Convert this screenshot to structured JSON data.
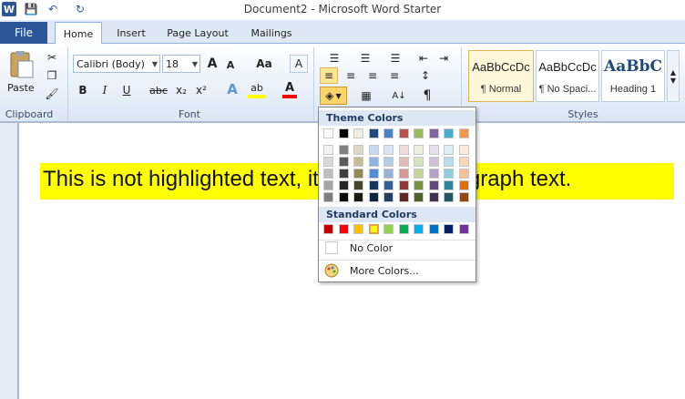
{
  "window": {
    "title": "Document2 - Microsoft Word Starter"
  },
  "quick_access": {
    "word_logo": "W",
    "save_icon": "💾",
    "undo_icon": "↶",
    "redo_icon": "↻"
  },
  "tabs": {
    "file": "File",
    "home": "Home",
    "insert": "Insert",
    "page_layout": "Page Layout",
    "mailings": "Mailings"
  },
  "clipboard": {
    "paste": "Paste",
    "group": "Clipboard"
  },
  "font": {
    "name": "Calibri (Body)",
    "size": "18",
    "group": "Font",
    "grow": "A",
    "shrink": "A",
    "case": "Aa",
    "bold": "B",
    "italic": "I",
    "underline": "U",
    "strike": "abc",
    "subscript": "x₂",
    "superscript": "x²",
    "effects": "A",
    "highlight": "ab",
    "color": "A"
  },
  "paragraph": {
    "bullets": "☰",
    "numbering": "☰",
    "multilevel": "☰",
    "outdent": "⇤",
    "indent": "⇥",
    "sort": "A↓",
    "pilcrow": "¶",
    "align_left": "≡",
    "align_center": "≡",
    "align_right": "≡",
    "justify": "≡",
    "line_spacing": "↕",
    "shading": "◈",
    "borders": "▦"
  },
  "styles": {
    "group": "Styles",
    "items": [
      {
        "preview": "AaBbCcDc",
        "name": "¶ Normal"
      },
      {
        "preview": "AaBbCcDc",
        "name": "¶ No Spaci..."
      },
      {
        "preview": "AaBbC",
        "name": "Heading 1"
      }
    ]
  },
  "document": {
    "text": "This is not highlighted text, it is shaded paragraph text."
  },
  "shading_dropdown": {
    "theme_header": "Theme Colors",
    "standard_header": "Standard Colors",
    "no_color": "No Color",
    "more_colors": "More Colors...",
    "theme_top": [
      "#ffffff",
      "#000000",
      "#eeece1",
      "#1f497d",
      "#4f81bd",
      "#c0504d",
      "#9bbb59",
      "#8064a2",
      "#4bacc6",
      "#f79646"
    ],
    "theme_shades": [
      [
        "#f2f2f2",
        "#7f7f7f",
        "#ddd9c3",
        "#c6d9f0",
        "#dbe5f1",
        "#f2dcdb",
        "#ebf1dd",
        "#e5e0ec",
        "#dbeef3",
        "#fdeada"
      ],
      [
        "#d8d8d8",
        "#595959",
        "#c4bd97",
        "#8db3e2",
        "#b8cce4",
        "#e5b9b7",
        "#d7e3bc",
        "#ccc1d9",
        "#b7dde8",
        "#fbd5b5"
      ],
      [
        "#bfbfbf",
        "#3f3f3f",
        "#938953",
        "#548dd4",
        "#95b3d7",
        "#d99694",
        "#c3d69b",
        "#b2a2c7",
        "#92cddc",
        "#fac08f"
      ],
      [
        "#a5a5a5",
        "#262626",
        "#494429",
        "#17365d",
        "#366092",
        "#953734",
        "#76923c",
        "#5f497a",
        "#31859b",
        "#e36c09"
      ],
      [
        "#7f7f7f",
        "#0c0c0c",
        "#1d1b10",
        "#0f243e",
        "#244061",
        "#632423",
        "#4f6128",
        "#3f3151",
        "#205867",
        "#974806"
      ]
    ],
    "standard": [
      "#c00000",
      "#ff0000",
      "#ffc000",
      "#ffff00",
      "#92d050",
      "#00b050",
      "#00b0f0",
      "#0070c0",
      "#002060",
      "#7030a0"
    ],
    "selected_standard": 3
  }
}
